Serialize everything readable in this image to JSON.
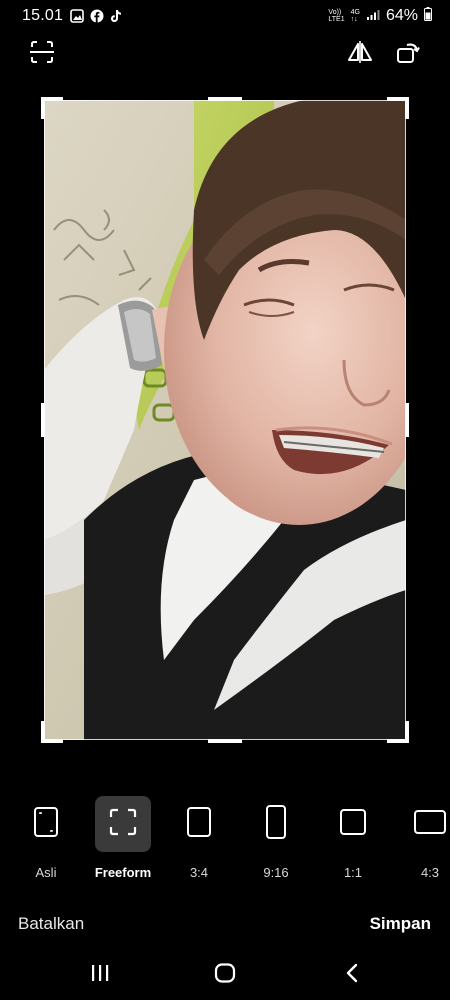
{
  "status_bar": {
    "time": "15.01",
    "notification_icons": [
      "gallery-icon",
      "facebook-icon",
      "tiktok-icon"
    ],
    "network_top": "Vo))",
    "network_bottom": "LTE1",
    "network_type": "4G",
    "battery_percent": "64%"
  },
  "toolbar": {
    "left_icon": "auto-crop-icon",
    "flip_icon": "flip-icon",
    "rotate_icon": "rotate-icon"
  },
  "ratios": [
    {
      "label": "Asli",
      "icon": "original-ratio-icon",
      "selected": false
    },
    {
      "label": "Freeform",
      "icon": "freeform-icon",
      "selected": true
    },
    {
      "label": "3:4",
      "icon": "ratio-3-4-icon",
      "selected": false
    },
    {
      "label": "9:16",
      "icon": "ratio-9-16-icon",
      "selected": false
    },
    {
      "label": "1:1",
      "icon": "ratio-1-1-icon",
      "selected": false
    },
    {
      "label": "4:3",
      "icon": "ratio-4-3-icon",
      "selected": false
    }
  ],
  "actions": {
    "cancel_label": "Batalkan",
    "save_label": "Simpan"
  },
  "nav": {
    "recents_icon": "recents-icon",
    "home_icon": "home-icon",
    "back_icon": "back-icon"
  },
  "colors": {
    "background": "#000000",
    "selected_ratio_bg": "#3a3a3a"
  }
}
